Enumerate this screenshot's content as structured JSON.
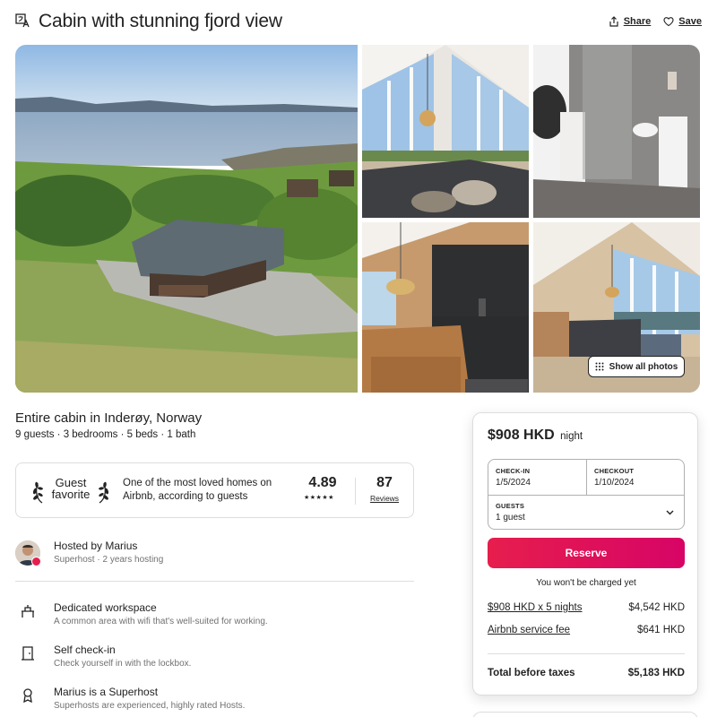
{
  "header": {
    "title": "Cabin with stunning fjord view",
    "share_label": "Share",
    "save_label": "Save",
    "icons": [
      "translate-icon",
      "share-icon",
      "heart-icon"
    ]
  },
  "gallery": {
    "show_all_label": "Show all photos",
    "icons": [
      "grid-dots-icon"
    ]
  },
  "listing": {
    "type": "Entire cabin in Inderøy, Norway",
    "facts": "9 guests · 3 bedrooms · 5 beds · 1 bath"
  },
  "guest_favorite": {
    "label_line1": "Guest",
    "label_line2": "favorite",
    "description": "One of the most loved homes on Airbnb, according to guests",
    "rating": "4.89",
    "stars": "★★★★★",
    "reviews_count": "87",
    "reviews_label": "Reviews"
  },
  "host": {
    "title": "Hosted by Marius",
    "subtitle": "Superhost · 2 years hosting"
  },
  "amenities": [
    {
      "title": "Dedicated workspace",
      "subtitle": "A common area with wifi that's well-suited for working.",
      "icon": "workspace-icon"
    },
    {
      "title": "Self check-in",
      "subtitle": "Check yourself in with the lockbox.",
      "icon": "door-icon"
    },
    {
      "title": "Marius is a Superhost",
      "subtitle": "Superhosts are experienced, highly rated Hosts.",
      "icon": "medal-icon"
    }
  ],
  "booking": {
    "price": "$908 HKD",
    "per": "night",
    "checkin_label": "CHECK-IN",
    "checkin_value": "1/5/2024",
    "checkout_label": "CHECKOUT",
    "checkout_value": "1/10/2024",
    "guests_label": "GUESTS",
    "guests_value": "1 guest",
    "reserve_label": "Reserve",
    "no_charge": "You won't be charged yet",
    "nights_label": "$908 HKD x 5 nights",
    "nights_value": "$4,542 HKD",
    "fee_label": "Airbnb service fee",
    "fee_value": "$641 HKD",
    "total_label": "Total before taxes",
    "total_value": "$5,183 HKD",
    "accent_color": "#E61E4D"
  }
}
